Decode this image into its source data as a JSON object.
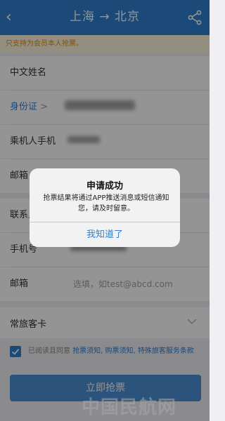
{
  "nav": {
    "title": "上海 → 北京",
    "back_icon": "back-chevron-icon",
    "share_icon": "share-icon"
  },
  "notice": {
    "text": "只支持为会员本人抢票。"
  },
  "form": {
    "name_label": "中文姓名",
    "id_label": "身份证",
    "id_chevron": ">",
    "phone_label": "乘机人手机",
    "email_label": "邮箱"
  },
  "contact": {
    "contact_label": "联系人",
    "mobile_label": "手机号",
    "email_label": "邮箱",
    "email_placeholder": "选填，如test@abcd.com"
  },
  "frequent": {
    "label": "常旅客卡"
  },
  "agreement": {
    "prefix": "已阅读且同意",
    "links": "抢票须知, 购票须知, 特殊旅客服务条款"
  },
  "submit_label": "立即抢票",
  "dialog": {
    "title": "申请成功",
    "message": "抢票结果将通过APP推送消息或短信通知您，请及时留意。",
    "button": "我知道了"
  },
  "watermark": "中国民航网",
  "colors": {
    "brand_blue": "#2f80d0",
    "notice_text": "#e08a1c",
    "notice_bg": "#fdf6dc"
  }
}
